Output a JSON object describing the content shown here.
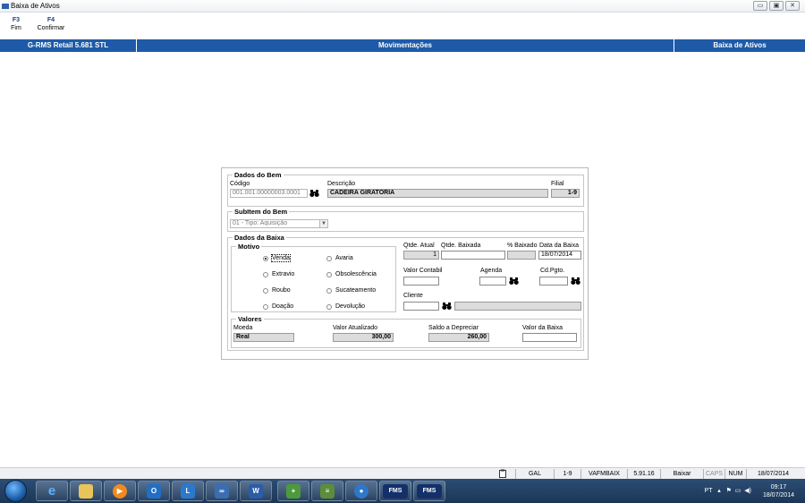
{
  "window": {
    "title": "Baixa de Ativos",
    "buttons": {
      "minimize": "▭",
      "maximize": "▣",
      "close": "✕"
    }
  },
  "toolbar": {
    "items": [
      {
        "key": "F3",
        "label": "Fim"
      },
      {
        "key": "F4",
        "label": "Confirmar"
      }
    ]
  },
  "header": {
    "app": "G-RMS Retail 5.681 STL",
    "module": "Movimentações",
    "screen": "Baixa de Ativos",
    "background": "#1e5aa8"
  },
  "dados_bem": {
    "title": "Dados do Bem",
    "codigo_label": "Código",
    "codigo_value": "001.001.00000003.0001",
    "descricao_label": "Descrição",
    "descricao_value": "CADEIRA GIRATORIA",
    "filial_label": "Filial",
    "filial_value": "1-9"
  },
  "subitem": {
    "title": "SubItem do Bem",
    "selected": "01 - Tipo: Aquisição"
  },
  "dados_baixa": {
    "title": "Dados da Baixa",
    "motivo": {
      "title": "Motivo",
      "options": [
        "Venda",
        "Avaria",
        "Extravio",
        "Obsolescência",
        "Roubo",
        "Sucateamento",
        "Doação",
        "Devolução"
      ],
      "selected": "Venda"
    },
    "qtde_atual_label": "Qtde. Atual",
    "qtde_atual_value": "1",
    "qtde_baixada_label": "Qtde. Baixada",
    "qtde_baixada_value": "",
    "pct_baixado_label": "% Baixado",
    "pct_baixado_value": "",
    "data_baixa_label": "Data da Baixa",
    "data_baixa_value": "18/07/2014",
    "valor_contabil_label": "Valor Contabil",
    "valor_contabil_value": "",
    "agenda_label": "Agenda",
    "agenda_value": "",
    "cd_pgto_label": "Cd.Pgto.",
    "cd_pgto_value": "",
    "cliente_label": "Cliente",
    "cliente_value": "",
    "cliente_nome": ""
  },
  "valores": {
    "title": "Valores",
    "moeda_label": "Moeda",
    "moeda_value": "Real",
    "valor_atualizado_label": "Valor Atualizado",
    "valor_atualizado_value": "300,00",
    "saldo_label": "Saldo a Depreciar",
    "saldo_value": "260,00",
    "valor_baixa_label": "Valor da Baixa",
    "valor_baixa_value": ""
  },
  "statusbar": {
    "cells": [
      "GAL",
      "1-9",
      "VAFMBAIX",
      "5.91.16",
      "Baixar",
      "CAPS",
      "NUM",
      "18/07/2014"
    ]
  },
  "taskbar": {
    "icons": [
      "ie-icon",
      "explorer-icon",
      "media-player-icon",
      "outlook-icon",
      "lync-icon",
      "app-icon",
      "word-icon",
      "app-icon-2",
      "app-icon-3",
      "app-icon-4",
      "fms-icon",
      "fms-icon-2"
    ],
    "fms_label": "FMS",
    "tray_lang": "PT",
    "clock_time": "09:17",
    "clock_date": "18/07/2014"
  }
}
